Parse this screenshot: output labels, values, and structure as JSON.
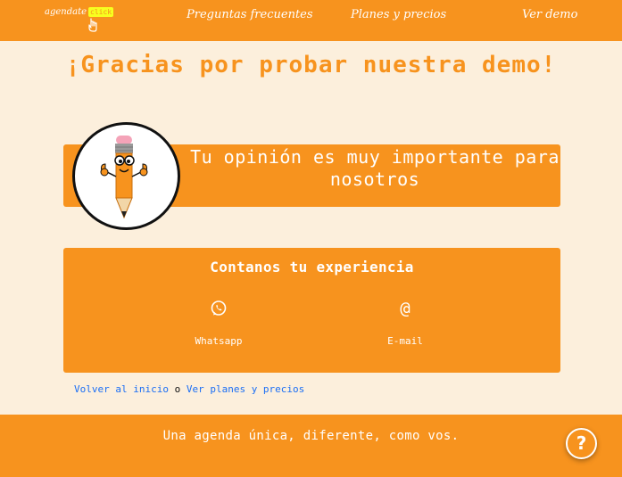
{
  "nav": {
    "logo_text": "agendate",
    "logo_badge": "click",
    "links": [
      "Preguntas frecuentes",
      "Planes y precios",
      "Ver demo"
    ]
  },
  "main": {
    "title": "¡Gracias por probar nuestra demo!",
    "opinion": "Tu opinión es muy importante para nosotros",
    "contact_title": "Contanos tu experiencia",
    "contact_items": [
      {
        "icon": "whatsapp-icon",
        "label": "Whatsapp"
      },
      {
        "icon": "at-icon",
        "label": "E-mail"
      }
    ]
  },
  "links": {
    "back": "Volver al inicio",
    "separator": "o",
    "plans": "Ver planes y precios"
  },
  "footer": {
    "tagline": "Una agenda única, diferente, como vos.",
    "help_label": "?"
  },
  "colors": {
    "accent": "#f7931e",
    "background": "#fcefdc",
    "link": "#1a6ef5",
    "badge": "#f7ff1f"
  }
}
